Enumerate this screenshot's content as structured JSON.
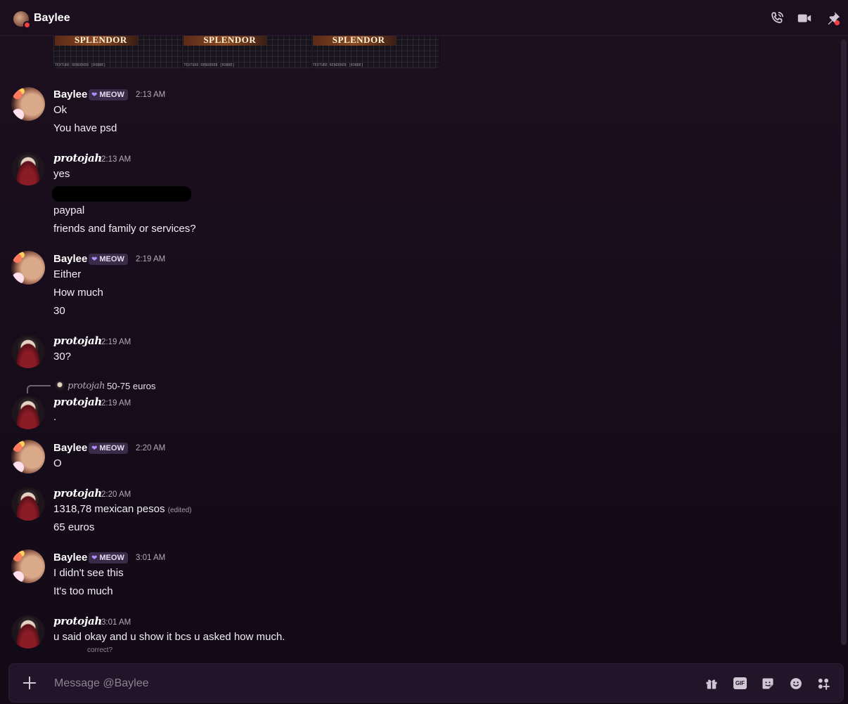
{
  "header": {
    "title": "Baylee",
    "icons": [
      "phone-call-icon",
      "video-call-icon",
      "pin-icon"
    ],
    "status_color": "#f23f43"
  },
  "attachment": {
    "panels": [
      {
        "brand": "SPLENDOR",
        "caption": "TEXTURE RENDERER [ROBBE]"
      },
      {
        "brand": "SPLENDOR",
        "caption": "TEXTURE RENDERER [ROBBE]"
      },
      {
        "brand": "SPLENDOR",
        "caption": "TEXTURE RENDERER [ROBBE]"
      }
    ]
  },
  "messages": [
    {
      "author": "Baylee",
      "tag": "MEOW",
      "time": "2:13 AM",
      "lines": [
        "Ok",
        "You have psd"
      ]
    },
    {
      "author": "protojah",
      "time": "2:13 AM",
      "lines": [
        "yes",
        "paypal",
        "friends and family or services?"
      ]
    },
    {
      "author": "Baylee",
      "tag": "MEOW",
      "time": "2:19 AM",
      "lines": [
        "Either",
        "How much",
        "30"
      ]
    },
    {
      "author": "protojah",
      "time": "2:19 AM",
      "lines": [
        "30?"
      ]
    },
    {
      "author": "protojah",
      "time": "2:19 AM",
      "reply": {
        "author": "protojah",
        "text": "50-75 euros"
      },
      "lines": [
        "."
      ]
    },
    {
      "author": "Baylee",
      "tag": "MEOW",
      "time": "2:20 AM",
      "lines": [
        "O"
      ]
    },
    {
      "author": "protojah",
      "time": "2:20 AM",
      "lines": [
        "1318,78 mexican pesos",
        "65 euros"
      ],
      "edited": "(edited)"
    },
    {
      "author": "Baylee",
      "tag": "MEOW",
      "time": "3:01 AM",
      "lines": [
        "I didn't see this",
        "It's too much"
      ]
    },
    {
      "author": "protojah",
      "time": "3:01 AM",
      "lines": [
        "u said okay and u show it bcs u asked how much."
      ]
    }
  ],
  "typing_fragment": "correct?",
  "composer": {
    "placeholder": "Message @Baylee",
    "gif_label": "GIF",
    "icons": [
      "plus-icon",
      "gift-icon",
      "gif-icon",
      "sticker-icon",
      "emoji-icon",
      "apps-icon"
    ]
  },
  "colors": {
    "background": "#160c1a",
    "tag_heart": "#b58cff"
  }
}
